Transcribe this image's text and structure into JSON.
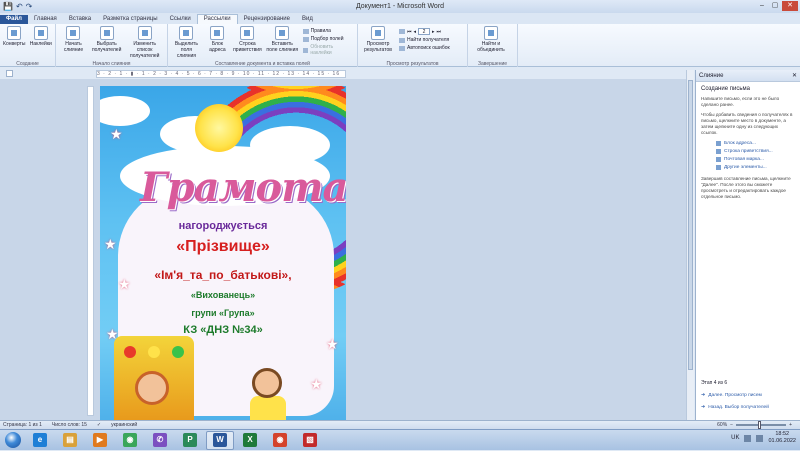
{
  "window": {
    "title": "Документ1 - Microsoft Word",
    "minimize": "–",
    "maximize": "▢",
    "close": "✕"
  },
  "qat": {
    "save": "💾",
    "undo": "↶",
    "redo": "↷"
  },
  "ribbon": {
    "tabs": [
      "Файл",
      "Главная",
      "Вставка",
      "Разметка страницы",
      "Ссылки",
      "Рассылки",
      "Рецензирование",
      "Вид"
    ],
    "active_tab": "Рассылки",
    "groups": {
      "create": {
        "label": "Создание",
        "buttons": [
          "Конверты",
          "Наклейки"
        ]
      },
      "start_merge": {
        "label": "Начало слияния",
        "buttons": [
          "Начать слияние",
          "Выбрать получателей",
          "Изменить список получателей"
        ]
      },
      "write_insert": {
        "label": "Составление документа и вставка полей",
        "buttons": [
          "Выделить поля слияния",
          "Блок адреса",
          "Строка приветствия",
          "Вставить поле слияния"
        ],
        "small": [
          "Правила",
          "Подбор полей",
          "Обновить наклейки"
        ]
      },
      "preview": {
        "label": "Просмотр результатов",
        "buttons": [
          "Просмотр результатов"
        ],
        "record": "2",
        "small": [
          "Найти получателя",
          "Автопоиск ошибок"
        ]
      },
      "finish": {
        "label": "Завершение",
        "buttons": [
          "Найти и объединить"
        ]
      }
    }
  },
  "ruler": {
    "text": "3 · 2 · 1 · ▮ · 1 · 2 · 3 · 4 · 5 · 6 · 7 · 8 · 9 · 10 · 11 · 12 · 13 · 14 · 15 · 16"
  },
  "certificate": {
    "heading": "Грамота",
    "line1": "нагороджується",
    "line2": "«Прізвище»",
    "line3": "«Ім'я_та_по_батькові»,",
    "line4": "«Вихованець»",
    "line5": "групи «Група»",
    "line6": "КЗ «ДНЗ №34»"
  },
  "pane": {
    "title": "Слияние",
    "close": "✕",
    "heading": "Создание письма",
    "p1": "Напишите письмо, если это не было сделано ранее.",
    "p2": "Чтобы добавить сведения о получателях в письмо, щелкните место в документе, а затем щелкните одну из следующих ссылок.",
    "options": [
      "Блок адреса...",
      "Строка приветствия...",
      "Почтовая марка...",
      "Другие элементы..."
    ],
    "p3": "Завершив составление письма, щелкните \"Далее\". После этого вы сможете просмотреть и отредактировать каждое отдельное письмо.",
    "step": "Этап 4 из 6",
    "next": "Далее. Просмотр писем",
    "back": "Назад. Выбор получателей"
  },
  "status": {
    "page": "Страница: 1 из 1",
    "words": "Число слов: 15",
    "lang": "украинский",
    "zoom": "60%"
  },
  "taskbar": {
    "apps": [
      {
        "name": "ie",
        "glyph": "e",
        "color": "#1e7fd6"
      },
      {
        "name": "explorer",
        "glyph": "▤",
        "color": "#d9a13a"
      },
      {
        "name": "media",
        "glyph": "▶",
        "color": "#e07a1e"
      },
      {
        "name": "chrome",
        "glyph": "◉",
        "color": "#3aa65a"
      },
      {
        "name": "viber",
        "glyph": "✆",
        "color": "#7b4fc0"
      },
      {
        "name": "publisher",
        "glyph": "P",
        "color": "#2b8a5a"
      },
      {
        "name": "word",
        "glyph": "W",
        "color": "#2b579a"
      },
      {
        "name": "excel",
        "glyph": "X",
        "color": "#1f7a3a"
      },
      {
        "name": "chrome2",
        "glyph": "◉",
        "color": "#d4432b"
      },
      {
        "name": "pdf",
        "glyph": "▧",
        "color": "#c22a2a"
      }
    ],
    "lang": "UK",
    "time": "18:52",
    "date": "01.06.2022"
  },
  "colors": {
    "accent": "#2b579a",
    "ribbon_bg": "#e3ecf7",
    "doc_bg": "#c8d6e8"
  }
}
